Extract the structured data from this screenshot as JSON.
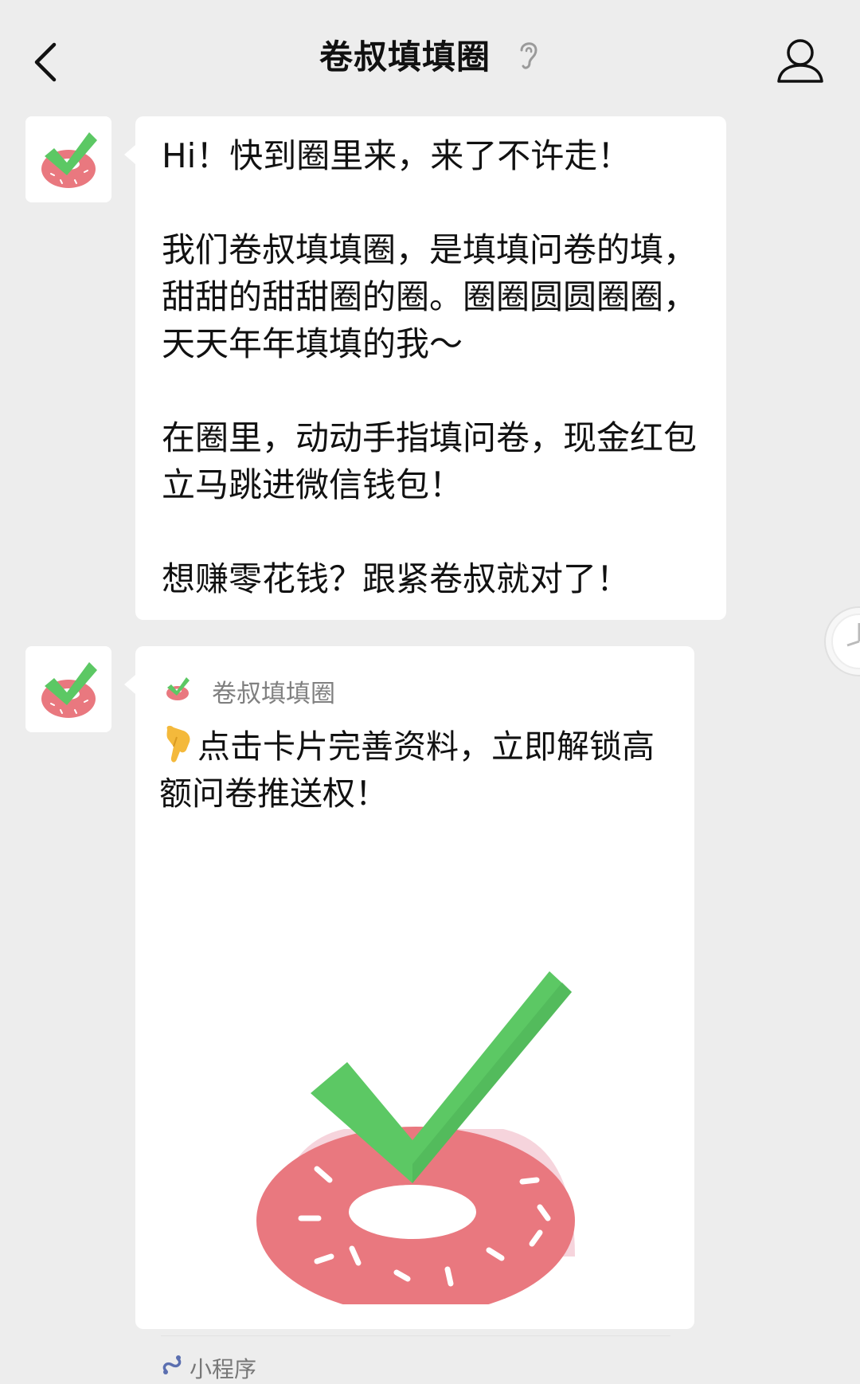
{
  "header": {
    "title": "卷叔填填圈"
  },
  "messages": [
    {
      "sender": "卷叔填填圈",
      "text": "Hi！快到圈里来，来了不许走！\n\n我们卷叔填填圈，是填填问卷的填，甜甜的甜甜圈的圈。圈圈圆圆圈圈，天天年年填填的我～\n\n在圈里，动动手指填问卷，现金红包立马跳进微信钱包！\n\n想赚零花钱？跟紧卷叔就对了！"
    }
  ],
  "card": {
    "source_name": "卷叔填填圈",
    "title": "点击卡片完善资料，立即解锁高额问卷推送权！",
    "footer_label": "小程序"
  },
  "colors": {
    "background": "#ededed",
    "bubble": "#ffffff",
    "check_green": "#5cc864",
    "donut_pink": "#e9787f"
  },
  "icons": [
    "back-arrow-icon",
    "ear-icon",
    "profile-icon",
    "finger-point-down-icon",
    "mini-program-icon",
    "clock-icon"
  ]
}
